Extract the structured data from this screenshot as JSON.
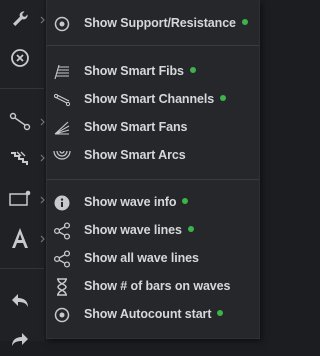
{
  "colors": {
    "background": "#1c1d20",
    "menu_bg": "#26272b",
    "text": "#d6d7da",
    "icon": "#c8c9cc",
    "active_dot": "#3cb44b"
  },
  "toolbar": {
    "tools": [
      {
        "name": "wrench-icon"
      },
      {
        "name": "close-circle-icon"
      },
      {
        "name": "line-tool-icon"
      },
      {
        "name": "fib-tool-icon"
      },
      {
        "name": "rectangle-tool-icon"
      },
      {
        "name": "text-tool-icon"
      },
      {
        "name": "undo-icon"
      },
      {
        "name": "redo-icon"
      }
    ]
  },
  "menu": {
    "items": [
      {
        "label": "Show Support/Resistance",
        "icon": "radio-dot-icon",
        "active": true
      },
      {
        "label": "Show Smart Fibs",
        "icon": "fibs-icon",
        "active": true
      },
      {
        "label": "Show Smart Channels",
        "icon": "channels-icon",
        "active": true
      },
      {
        "label": "Show Smart Fans",
        "icon": "fans-icon",
        "active": false
      },
      {
        "label": "Show Smart Arcs",
        "icon": "arcs-icon",
        "active": false
      },
      {
        "label": "Show wave info",
        "icon": "info-icon",
        "active": true
      },
      {
        "label": "Show wave lines",
        "icon": "share-icon",
        "active": true
      },
      {
        "label": "Show all wave lines",
        "icon": "share-icon",
        "active": false
      },
      {
        "label": "Show # of bars on waves",
        "icon": "hourglass-icon",
        "active": false
      },
      {
        "label": "Show Autocount start",
        "icon": "radio-dot-icon",
        "active": true
      }
    ]
  }
}
